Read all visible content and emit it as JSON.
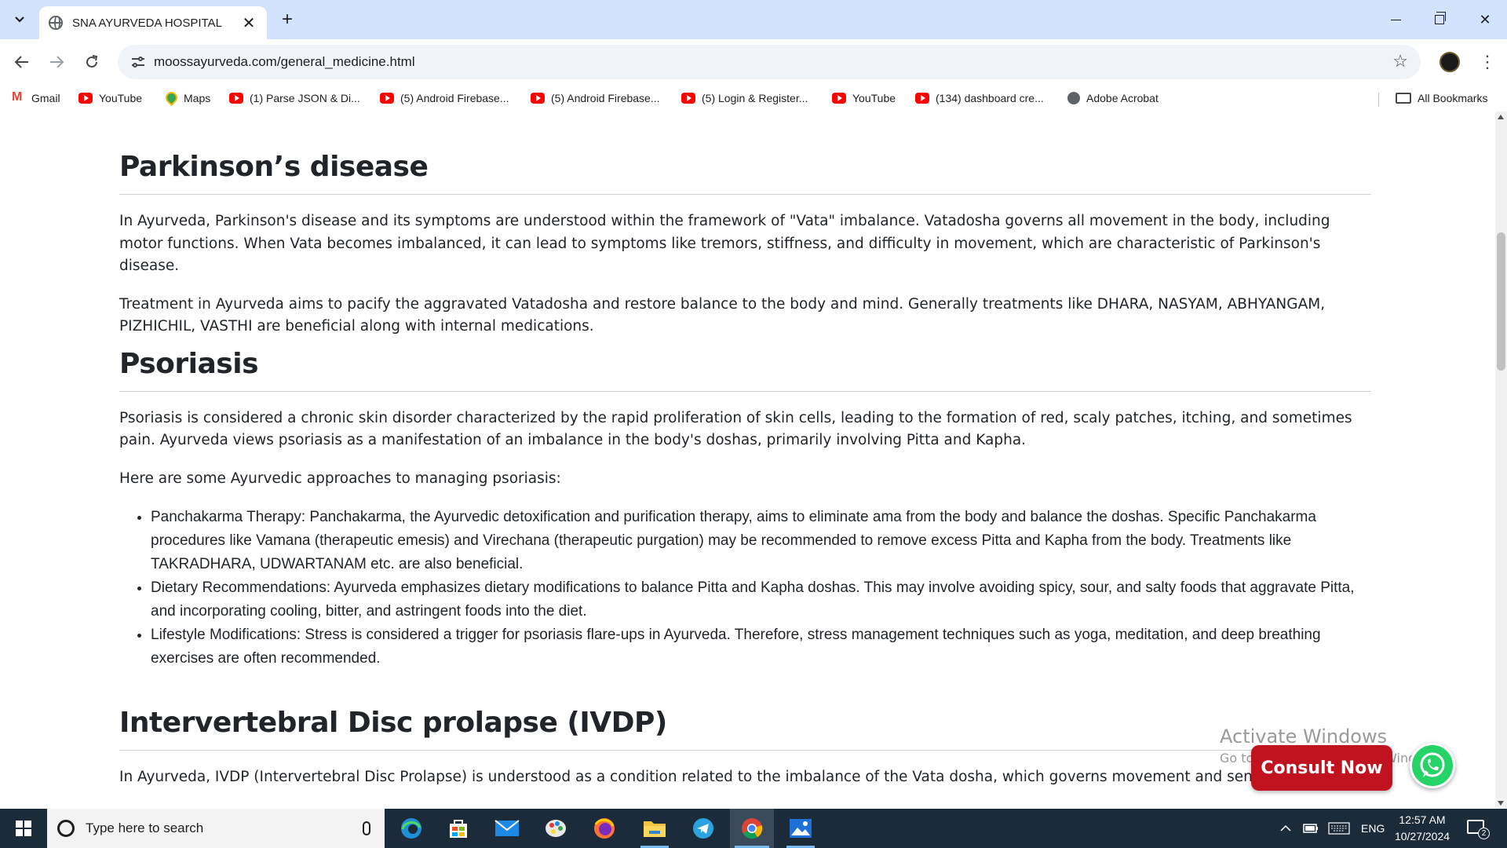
{
  "browser": {
    "tab": {
      "title": "SNA AYURVEDA HOSPITAL"
    },
    "url": "moossayurveda.com/general_medicine.html",
    "bookmarks": [
      {
        "label": "Gmail",
        "icon": "gmail-icon"
      },
      {
        "label": "YouTube",
        "icon": "youtube-icon"
      },
      {
        "label": "Maps",
        "icon": "maps-icon"
      },
      {
        "label": "(1) Parse JSON & Di...",
        "icon": "youtube-icon"
      },
      {
        "label": "(5) Android Firebase...",
        "icon": "youtube-icon"
      },
      {
        "label": "(5) Android Firebase...",
        "icon": "youtube-icon"
      },
      {
        "label": "(5) Login & Register...",
        "icon": "youtube-icon"
      },
      {
        "label": "YouTube",
        "icon": "youtube-icon"
      },
      {
        "label": "(134) dashboard cre...",
        "icon": "youtube-icon"
      },
      {
        "label": "Adobe Acrobat",
        "icon": "globe-icon"
      }
    ],
    "all_bookmarks": "All Bookmarks"
  },
  "page": {
    "sections": [
      {
        "heading": "Parkinson’s disease",
        "paragraphs": [
          "In Ayurveda, Parkinson's disease and its symptoms are understood within the framework of \"Vata\" imbalance. Vatadosha governs all movement in the body, including motor functions. When Vata becomes imbalanced, it can lead to symptoms like tremors, stiffness, and difficulty in movement, which are characteristic of Parkinson's disease.",
          "Treatment in Ayurveda aims to pacify the aggravated Vatadosha and restore balance to the body and mind. Generally treatments like DHARA, NASYAM, ABHYANGAM, PIZHICHIL, VASTHI are beneficial along with internal medications."
        ]
      },
      {
        "heading": "Psoriasis",
        "paragraphs": [
          "Psoriasis is considered a chronic skin disorder characterized by the rapid proliferation of skin cells, leading to the formation of red, scaly patches, itching, and sometimes pain. Ayurveda views psoriasis as a manifestation of an imbalance in the body's doshas, primarily involving Pitta and Kapha.",
          "Here are some Ayurvedic approaches to managing psoriasis:"
        ],
        "bullets": [
          "Panchakarma Therapy: Panchakarma, the Ayurvedic detoxification and purification therapy, aims to eliminate ama from the body and balance the doshas. Specific Panchakarma procedures like Vamana (therapeutic emesis) and Virechana (therapeutic purgation) may be recommended to remove excess Pitta and Kapha from the body. Treatments like TAKRADHARA, UDWARTANAM etc. are also beneficial.",
          "Dietary Recommendations: Ayurveda emphasizes dietary modifications to balance Pitta and Kapha doshas. This may involve avoiding spicy, sour, and salty foods that aggravate Pitta, and incorporating cooling, bitter, and astringent foods into the diet.",
          "Lifestyle Modifications: Stress is considered a trigger for psoriasis flare-ups in Ayurveda. Therefore, stress management techniques such as yoga, meditation, and deep breathing exercises are often recommended."
        ]
      },
      {
        "heading": "Intervertebral Disc prolapse (IVDP)",
        "paragraphs": [
          "In Ayurveda, IVDP (Intervertebral Disc Prolapse) is understood as a condition related to the imbalance of the Vata dosha, which governs movement and sensory"
        ]
      }
    ],
    "consult_label": "Consult Now",
    "accent_color": "#c1121f",
    "whatsapp_color": "#25d366"
  },
  "watermark": {
    "line1": "Activate Windows",
    "line2": "Go to Settings to activate Windows."
  },
  "taskbar": {
    "search_placeholder": "Type here to search",
    "language": "ENG",
    "time": "12:57 AM",
    "date": "10/27/2024",
    "notification_count": "2",
    "apps": [
      "edge-icon",
      "store-icon",
      "mail-icon",
      "paint-icon",
      "firefox-icon",
      "file-explorer-icon",
      "telegram-icon",
      "chrome-icon",
      "photos-icon"
    ]
  }
}
